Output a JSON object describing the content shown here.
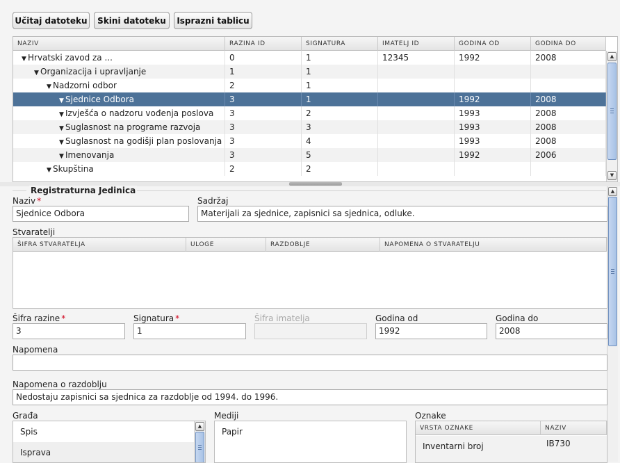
{
  "toolbar": {
    "load_label": "Učitaj datoteku",
    "download_label": "Skini datoteku",
    "clear_label": "Isprazni tablicu"
  },
  "tree": {
    "columns": [
      "NAZIV",
      "RAZINA ID",
      "SIGNATURA",
      "IMATELJ ID",
      "GODINA OD",
      "GODINA DO"
    ],
    "rows": [
      {
        "naziv": "Hrvatski zavod za ...",
        "level": 0,
        "razina": "0",
        "signatura": "1",
        "imatelj": "12345",
        "od": "1992",
        "do": "2008"
      },
      {
        "naziv": "Organizacija i upravljanje",
        "level": 1,
        "razina": "1",
        "signatura": "1",
        "imatelj": "",
        "od": "",
        "do": ""
      },
      {
        "naziv": "Nadzorni odbor",
        "level": 2,
        "razina": "2",
        "signatura": "1",
        "imatelj": "",
        "od": "",
        "do": ""
      },
      {
        "naziv": "Sjednice Odbora",
        "level": 3,
        "razina": "3",
        "signatura": "1",
        "imatelj": "",
        "od": "1992",
        "do": "2008",
        "selected": true
      },
      {
        "naziv": "Izvješća o nadzoru vođenja poslova",
        "level": 3,
        "razina": "3",
        "signatura": "2",
        "imatelj": "",
        "od": "1993",
        "do": "2008"
      },
      {
        "naziv": "Suglasnost na programe razvoja",
        "level": 3,
        "razina": "3",
        "signatura": "3",
        "imatelj": "",
        "od": "1993",
        "do": "2008"
      },
      {
        "naziv": "Suglasnost na godišji plan poslovanja",
        "level": 3,
        "razina": "3",
        "signatura": "4",
        "imatelj": "",
        "od": "1993",
        "do": "2008"
      },
      {
        "naziv": "Imenovanja",
        "level": 3,
        "razina": "3",
        "signatura": "5",
        "imatelj": "",
        "od": "1992",
        "do": "2006"
      },
      {
        "naziv": "Skupština",
        "level": 2,
        "razina": "2",
        "signatura": "2",
        "imatelj": "",
        "od": "",
        "do": ""
      }
    ]
  },
  "form": {
    "legend": "Registraturna Jedinica",
    "naziv_label": "Naziv",
    "naziv_value": "Sjednice Odbora",
    "sadrzaj_label": "Sadržaj",
    "sadrzaj_value": "Materijali za sjednice, zapisnici sa sjednica, odluke.",
    "stvaratelji_label": "Stvaratelji",
    "stvaratelji_columns": [
      "ŠIFRA STVARATELJA",
      "ULOGE",
      "RAZDOBLJE",
      "NAPOMENA O STVARATELJU"
    ],
    "sifra_razine_label": "Šifra razine",
    "sifra_razine_value": "3",
    "signatura_label": "Signatura",
    "signatura_value": "1",
    "sifra_imatelja_label": "Šifra imatelja",
    "godina_od_label": "Godina od",
    "godina_od_value": "1992",
    "godina_do_label": "Godina do",
    "godina_do_value": "2008",
    "napomena_label": "Napomena",
    "napomena_value": "",
    "napomena_razdoblju_label": "Napomena o razdoblju",
    "napomena_razdoblju_value": "Nedostaju zapisnici sa sjednica za razdoblje od 1994. do 1996.",
    "gradja_label": "Građa",
    "gradja_items": [
      "Spis",
      "Isprava"
    ],
    "mediji_label": "Mediji",
    "mediji_items": [
      "Papir"
    ],
    "oznake_label": "Oznake",
    "oznake_columns": [
      "VRSTA OZNAKE",
      "NAZIV"
    ],
    "oznake_rows": [
      {
        "vrsta": "Inventarni broj",
        "naziv": "IB730"
      }
    ]
  }
}
